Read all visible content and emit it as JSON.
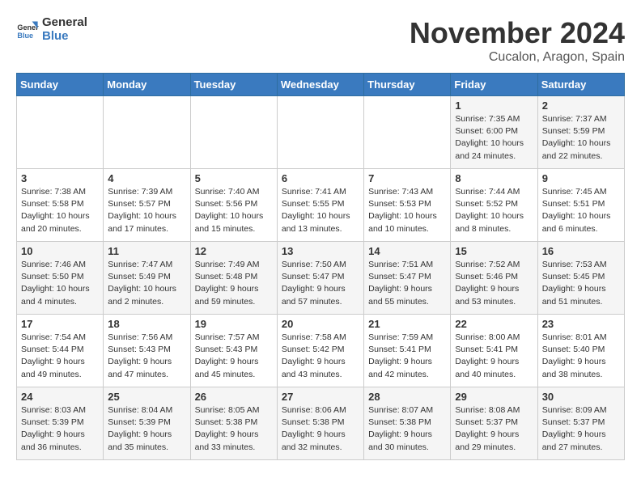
{
  "logo": {
    "line1": "General",
    "line2": "Blue"
  },
  "title": "November 2024",
  "location": "Cucalon, Aragon, Spain",
  "headers": [
    "Sunday",
    "Monday",
    "Tuesday",
    "Wednesday",
    "Thursday",
    "Friday",
    "Saturday"
  ],
  "weeks": [
    [
      {
        "day": "",
        "sunrise": "",
        "sunset": "",
        "daylight": ""
      },
      {
        "day": "",
        "sunrise": "",
        "sunset": "",
        "daylight": ""
      },
      {
        "day": "",
        "sunrise": "",
        "sunset": "",
        "daylight": ""
      },
      {
        "day": "",
        "sunrise": "",
        "sunset": "",
        "daylight": ""
      },
      {
        "day": "",
        "sunrise": "",
        "sunset": "",
        "daylight": ""
      },
      {
        "day": "1",
        "sunrise": "Sunrise: 7:35 AM",
        "sunset": "Sunset: 6:00 PM",
        "daylight": "Daylight: 10 hours and 24 minutes."
      },
      {
        "day": "2",
        "sunrise": "Sunrise: 7:37 AM",
        "sunset": "Sunset: 5:59 PM",
        "daylight": "Daylight: 10 hours and 22 minutes."
      }
    ],
    [
      {
        "day": "3",
        "sunrise": "Sunrise: 7:38 AM",
        "sunset": "Sunset: 5:58 PM",
        "daylight": "Daylight: 10 hours and 20 minutes."
      },
      {
        "day": "4",
        "sunrise": "Sunrise: 7:39 AM",
        "sunset": "Sunset: 5:57 PM",
        "daylight": "Daylight: 10 hours and 17 minutes."
      },
      {
        "day": "5",
        "sunrise": "Sunrise: 7:40 AM",
        "sunset": "Sunset: 5:56 PM",
        "daylight": "Daylight: 10 hours and 15 minutes."
      },
      {
        "day": "6",
        "sunrise": "Sunrise: 7:41 AM",
        "sunset": "Sunset: 5:55 PM",
        "daylight": "Daylight: 10 hours and 13 minutes."
      },
      {
        "day": "7",
        "sunrise": "Sunrise: 7:43 AM",
        "sunset": "Sunset: 5:53 PM",
        "daylight": "Daylight: 10 hours and 10 minutes."
      },
      {
        "day": "8",
        "sunrise": "Sunrise: 7:44 AM",
        "sunset": "Sunset: 5:52 PM",
        "daylight": "Daylight: 10 hours and 8 minutes."
      },
      {
        "day": "9",
        "sunrise": "Sunrise: 7:45 AM",
        "sunset": "Sunset: 5:51 PM",
        "daylight": "Daylight: 10 hours and 6 minutes."
      }
    ],
    [
      {
        "day": "10",
        "sunrise": "Sunrise: 7:46 AM",
        "sunset": "Sunset: 5:50 PM",
        "daylight": "Daylight: 10 hours and 4 minutes."
      },
      {
        "day": "11",
        "sunrise": "Sunrise: 7:47 AM",
        "sunset": "Sunset: 5:49 PM",
        "daylight": "Daylight: 10 hours and 2 minutes."
      },
      {
        "day": "12",
        "sunrise": "Sunrise: 7:49 AM",
        "sunset": "Sunset: 5:48 PM",
        "daylight": "Daylight: 9 hours and 59 minutes."
      },
      {
        "day": "13",
        "sunrise": "Sunrise: 7:50 AM",
        "sunset": "Sunset: 5:47 PM",
        "daylight": "Daylight: 9 hours and 57 minutes."
      },
      {
        "day": "14",
        "sunrise": "Sunrise: 7:51 AM",
        "sunset": "Sunset: 5:47 PM",
        "daylight": "Daylight: 9 hours and 55 minutes."
      },
      {
        "day": "15",
        "sunrise": "Sunrise: 7:52 AM",
        "sunset": "Sunset: 5:46 PM",
        "daylight": "Daylight: 9 hours and 53 minutes."
      },
      {
        "day": "16",
        "sunrise": "Sunrise: 7:53 AM",
        "sunset": "Sunset: 5:45 PM",
        "daylight": "Daylight: 9 hours and 51 minutes."
      }
    ],
    [
      {
        "day": "17",
        "sunrise": "Sunrise: 7:54 AM",
        "sunset": "Sunset: 5:44 PM",
        "daylight": "Daylight: 9 hours and 49 minutes."
      },
      {
        "day": "18",
        "sunrise": "Sunrise: 7:56 AM",
        "sunset": "Sunset: 5:43 PM",
        "daylight": "Daylight: 9 hours and 47 minutes."
      },
      {
        "day": "19",
        "sunrise": "Sunrise: 7:57 AM",
        "sunset": "Sunset: 5:43 PM",
        "daylight": "Daylight: 9 hours and 45 minutes."
      },
      {
        "day": "20",
        "sunrise": "Sunrise: 7:58 AM",
        "sunset": "Sunset: 5:42 PM",
        "daylight": "Daylight: 9 hours and 43 minutes."
      },
      {
        "day": "21",
        "sunrise": "Sunrise: 7:59 AM",
        "sunset": "Sunset: 5:41 PM",
        "daylight": "Daylight: 9 hours and 42 minutes."
      },
      {
        "day": "22",
        "sunrise": "Sunrise: 8:00 AM",
        "sunset": "Sunset: 5:41 PM",
        "daylight": "Daylight: 9 hours and 40 minutes."
      },
      {
        "day": "23",
        "sunrise": "Sunrise: 8:01 AM",
        "sunset": "Sunset: 5:40 PM",
        "daylight": "Daylight: 9 hours and 38 minutes."
      }
    ],
    [
      {
        "day": "24",
        "sunrise": "Sunrise: 8:03 AM",
        "sunset": "Sunset: 5:39 PM",
        "daylight": "Daylight: 9 hours and 36 minutes."
      },
      {
        "day": "25",
        "sunrise": "Sunrise: 8:04 AM",
        "sunset": "Sunset: 5:39 PM",
        "daylight": "Daylight: 9 hours and 35 minutes."
      },
      {
        "day": "26",
        "sunrise": "Sunrise: 8:05 AM",
        "sunset": "Sunset: 5:38 PM",
        "daylight": "Daylight: 9 hours and 33 minutes."
      },
      {
        "day": "27",
        "sunrise": "Sunrise: 8:06 AM",
        "sunset": "Sunset: 5:38 PM",
        "daylight": "Daylight: 9 hours and 32 minutes."
      },
      {
        "day": "28",
        "sunrise": "Sunrise: 8:07 AM",
        "sunset": "Sunset: 5:38 PM",
        "daylight": "Daylight: 9 hours and 30 minutes."
      },
      {
        "day": "29",
        "sunrise": "Sunrise: 8:08 AM",
        "sunset": "Sunset: 5:37 PM",
        "daylight": "Daylight: 9 hours and 29 minutes."
      },
      {
        "day": "30",
        "sunrise": "Sunrise: 8:09 AM",
        "sunset": "Sunset: 5:37 PM",
        "daylight": "Daylight: 9 hours and 27 minutes."
      }
    ]
  ]
}
